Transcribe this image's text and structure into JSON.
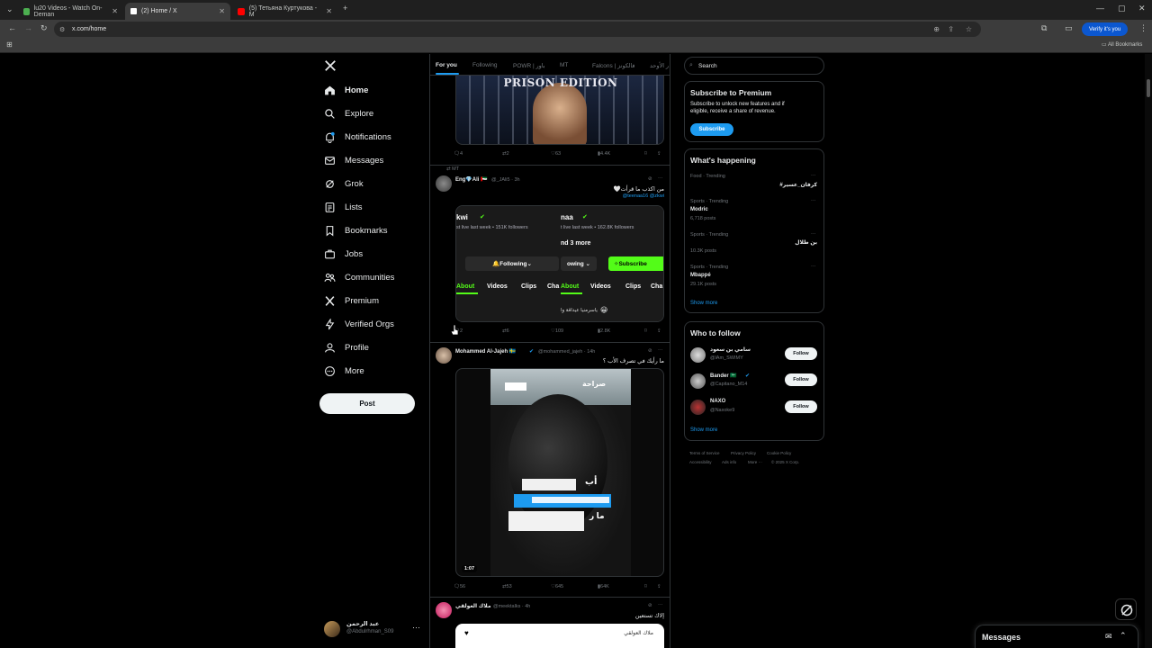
{
  "browser": {
    "tabs": [
      {
        "title": "lu20 Videos - Watch On-Deman",
        "color": "#4CAF50"
      },
      {
        "title": "(2) Home / X",
        "color": "#000000"
      },
      {
        "title": "(5) Тетьяна Куртукова - M",
        "color": "#ff0000"
      }
    ],
    "url": "x.com/home",
    "verify_label": "Verify it's you",
    "bookmarks_label": "All Bookmarks"
  },
  "nav": {
    "items": [
      {
        "label": "Home",
        "icon": "home-icon"
      },
      {
        "label": "Explore",
        "icon": "search-icon"
      },
      {
        "label": "Notifications",
        "icon": "bell-icon"
      },
      {
        "label": "Messages",
        "icon": "mail-icon"
      },
      {
        "label": "Grok",
        "icon": "grok-icon"
      },
      {
        "label": "Lists",
        "icon": "list-icon"
      },
      {
        "label": "Bookmarks",
        "icon": "bookmark-icon"
      },
      {
        "label": "Jobs",
        "icon": "briefcase-icon"
      },
      {
        "label": "Communities",
        "icon": "people-icon"
      },
      {
        "label": "Premium",
        "icon": "x-logo-icon"
      },
      {
        "label": "Verified Orgs",
        "icon": "lightning-icon"
      },
      {
        "label": "Profile",
        "icon": "person-icon"
      },
      {
        "label": "More",
        "icon": "more-circle-icon"
      }
    ],
    "post_label": "Post",
    "account": {
      "name": "عبد الرحمن",
      "handle": "@Abdulrhman_S09"
    }
  },
  "feed": {
    "tabs": [
      "For you",
      "Following",
      "POWR | باور",
      "MT",
      "Falcons | فالكونز",
      "ر الأوحد"
    ],
    "post1": {
      "banner": "PRISON EDITION",
      "replies": "4",
      "reposts": "2",
      "likes": "63",
      "views": "4.4K"
    },
    "post2": {
      "context": "MT",
      "name": "Eng💎Ali 🇦🇪",
      "handle": "@_JAli5 · 3h",
      "text": "من اكذب ما قرأت🤍",
      "mention": "@teenaa16 @zkwi",
      "embed": {
        "left_name": "kwi",
        "left_sub": "st live last week • 151K followers",
        "right_name": "naa",
        "right_sub": "t live last week • 162.8K followers",
        "more": "nd 3 more",
        "following": "Following",
        "following2": "owing",
        "subscribe": "Subscribe",
        "tabs": [
          "About",
          "Videos",
          "Clips",
          "Cha"
        ],
        "chat": "ياسرمنيا عيداقة وا"
      },
      "replies": "2",
      "reposts": "6",
      "likes": "109",
      "views": "2.8K"
    },
    "post3": {
      "name": "Mohammed Al-Jajeh 🇸🇪",
      "handle": "@mohammed_jajeh · 14h",
      "text": "ما رأيك في تصرف الأب ؟",
      "video_logo": "صراحة",
      "caption_text": "أب",
      "caption_text2": "ما ر",
      "duration": "1:07",
      "replies": "56",
      "reposts": "53",
      "likes": "645",
      "views": "64K"
    },
    "post4": {
      "name": "ملاك العولقي",
      "handle": "@meektalks · 4h",
      "text": "إلاك تستعين",
      "quote_name": "ملاك العولقي"
    }
  },
  "right": {
    "search_placeholder": "Search",
    "premium": {
      "title": "Subscribe to Premium",
      "body1": "Subscribe to unlock new features and if",
      "body2": "eligible, receive a share of revenue.",
      "button": "Subscribe"
    },
    "happening": {
      "title": "What's happening",
      "trends": [
        {
          "cat": "Food · Trending",
          "name": "#كرفان_عسير",
          "posts": ""
        },
        {
          "cat": "Sports · Trending",
          "name": "Modric",
          "posts": "6,718 posts"
        },
        {
          "cat": "Sports · Trending",
          "name": "بن طلال",
          "posts": "10.3K posts"
        },
        {
          "cat": "Sports · Trending",
          "name": "Mbappé",
          "posts": "29.1K posts"
        }
      ],
      "show_more": "Show more"
    },
    "follow": {
      "title": "Who to follow",
      "people": [
        {
          "name": "سامي بن سعود",
          "handle": "@lAm_SWIMY",
          "button": "Follow"
        },
        {
          "name": "Bander 🇸🇦",
          "handle": "@Capitano_M14",
          "button": "Follow"
        },
        {
          "name": "NAXO",
          "handle": "@Naxoke9",
          "button": "Follow"
        }
      ],
      "show_more": "Show more"
    },
    "footer": {
      "line1": [
        "Terms of Service",
        "Privacy Policy",
        "Cookie Policy"
      ],
      "line2": [
        "Accessibility",
        "Ads info",
        "More ···",
        "© 2025 X Corp."
      ]
    }
  },
  "messages_dock": {
    "title": "Messages"
  },
  "colors": {
    "accent": "#1d9bf0",
    "green": "#53fc18",
    "border": "#2f3336"
  }
}
